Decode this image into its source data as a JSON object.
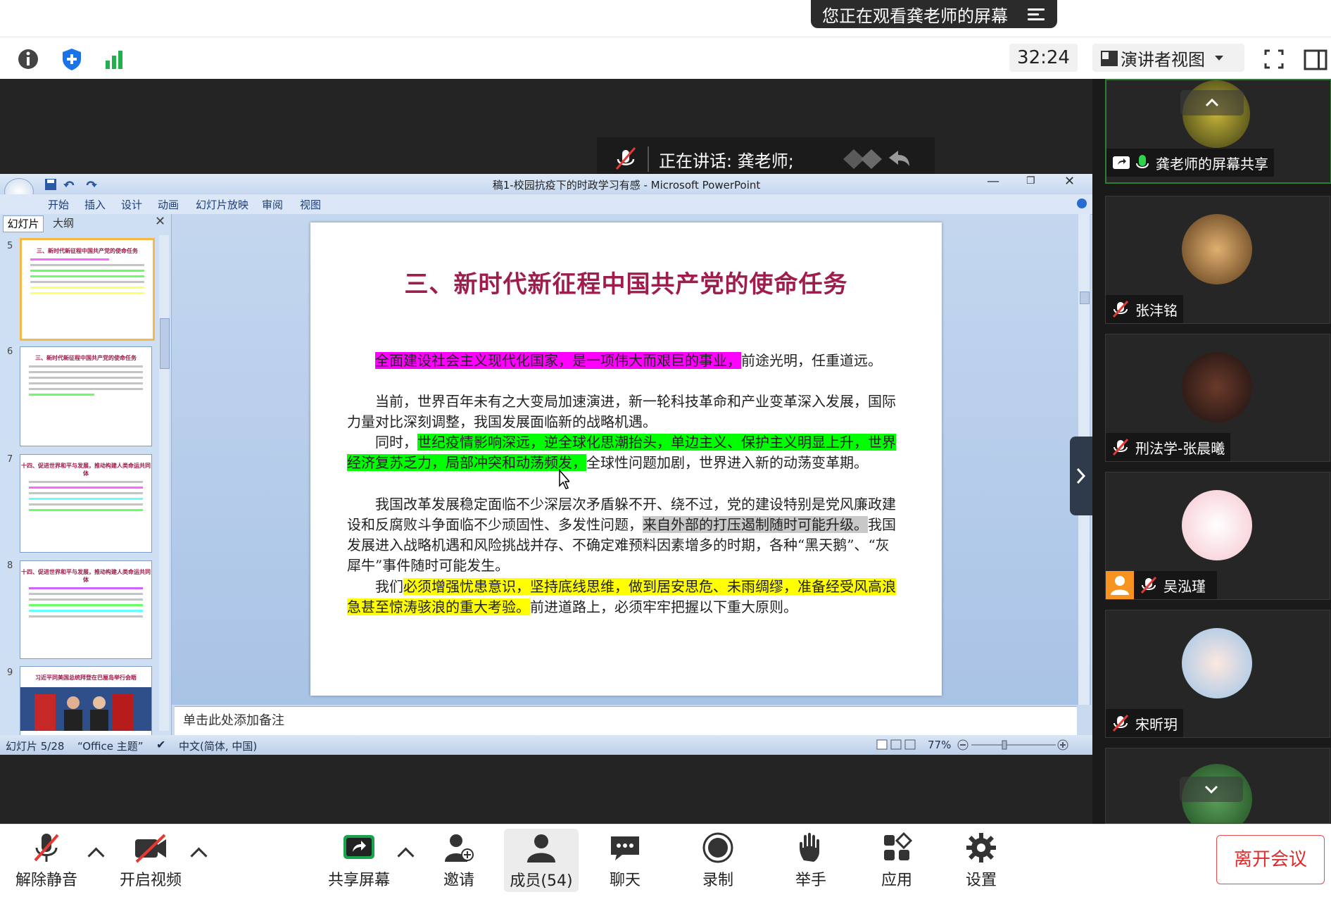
{
  "banner": {
    "viewing_text": "您正在观看龚老师的屏幕",
    "timer": "32:24",
    "view_mode": "演讲者视图"
  },
  "speaking": {
    "label": "正在讲话: 龚老师;"
  },
  "powerpoint": {
    "window_title": "稿1-校园抗疫下的时政学习有感 - Microsoft PowerPoint",
    "ribbon_tabs": [
      "开始",
      "插入",
      "设计",
      "动画",
      "幻灯片放映",
      "审阅",
      "视图"
    ],
    "panel_tabs": [
      "幻灯片",
      "大纲"
    ],
    "thumbnail_numbers": [
      "5",
      "6",
      "7",
      "8",
      "9"
    ],
    "thumbnail_titles": [
      "三、新时代新征程中国共产党的使命任务",
      "三、新时代新征程中国共产党的使命任务",
      "十四、促进世界和平与发展，推动构建人类命运共同体",
      "十四、促进世界和平与发展，推动构建人类命运共同体",
      "习近平同美国总统拜登在巴厘岛举行会晤"
    ],
    "notes_placeholder": "单击此处添加备注",
    "status": {
      "slide": "幻灯片 5/28",
      "theme": "“Office 主题”",
      "language": "中文(简体, 中国)",
      "zoom": "77%"
    },
    "slide": {
      "title": "三、新时代新征程中国共产党的使命任务",
      "p1_hl": "全面建设社会主义现代化国家，是一项伟大而艰巨的事业，",
      "p1_rest": "前途光明，任重道远。",
      "p2": "当前，世界百年未有之大变局加速演进，新一轮科技革命和产业变革深入发展，国际力量对比深刻调整，我国发展面临新的战略机遇。",
      "p3_a": "同时，",
      "p3_hl": "世纪疫情影响深远，逆全球化思潮抬头，单边主义、保护主义明显上升，世界经济复苏乏力，局部冲突和动荡频发，",
      "p3_rest": "全球性问题加剧，世界进入新的动荡变革期。",
      "p4_a": "我国改革发展稳定面临不少深层次矛盾躲不开、绕不过，党的建设特别是党风廉政建设和反腐败斗争面临不少顽固性、多发性问题，",
      "p4_hl": "来自外部的打压遏制随时可能升级。",
      "p4_rest": "我国发展进入战略机遇和风险挑战并存、不确定难预料因素增多的时期，各种“黑天鹅”、“灰犀牛”事件随时可能发生。",
      "p5_a": "我们",
      "p5_hl": "必须增强忧患意识，坚持底线思维，做到居安思危、未雨绸缪，准备经受风高浪急甚至惊涛骇浪的重大考验。",
      "p5_rest": "前进道路上，必须牢牢把握以下重大原则。"
    }
  },
  "participants": [
    {
      "name": "龚老师的屏幕共享"
    },
    {
      "name": "张沣铭"
    },
    {
      "name": "刑法学-张晨曦"
    },
    {
      "name": "吴泓瑾"
    },
    {
      "name": "宋昕玥"
    }
  ],
  "bottom": {
    "unmute": "解除静音",
    "video": "开启视频",
    "share": "共享屏幕",
    "invite": "邀请",
    "members": "成员(54)",
    "chat": "聊天",
    "record": "录制",
    "raise": "举手",
    "apps": "应用",
    "settings": "设置",
    "leave": "离开会议"
  }
}
